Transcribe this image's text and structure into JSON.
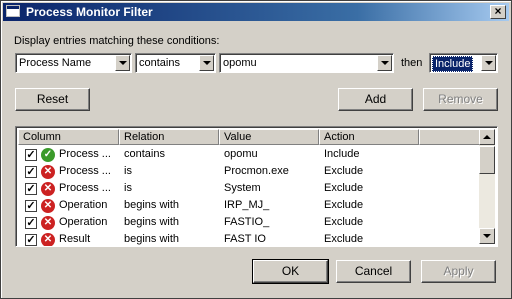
{
  "window": {
    "title": "Process Monitor Filter"
  },
  "filter": {
    "prompt": "Display entries matching these conditions:",
    "column": "Process Name",
    "relation": "contains",
    "value": "opomu",
    "then_label": "then",
    "action": "Include"
  },
  "buttons": {
    "reset": "Reset",
    "add": "Add",
    "remove": "Remove",
    "ok": "OK",
    "cancel": "Cancel",
    "apply": "Apply"
  },
  "list": {
    "headers": [
      "Column",
      "Relation",
      "Value",
      "Action"
    ],
    "rows": [
      {
        "checked": true,
        "status": "include",
        "column": "Process ...",
        "relation": "contains",
        "value": "opomu",
        "action": "Include"
      },
      {
        "checked": true,
        "status": "exclude",
        "column": "Process ...",
        "relation": "is",
        "value": "Procmon.exe",
        "action": "Exclude"
      },
      {
        "checked": true,
        "status": "exclude",
        "column": "Process ...",
        "relation": "is",
        "value": "System",
        "action": "Exclude"
      },
      {
        "checked": true,
        "status": "exclude",
        "column": "Operation",
        "relation": "begins with",
        "value": "IRP_MJ_",
        "action": "Exclude"
      },
      {
        "checked": true,
        "status": "exclude",
        "column": "Operation",
        "relation": "begins with",
        "value": "FASTIO_",
        "action": "Exclude"
      },
      {
        "checked": true,
        "status": "exclude",
        "column": "Result",
        "relation": "begins with",
        "value": "FAST IO",
        "action": "Exclude"
      }
    ]
  },
  "colors": {
    "title_bar": "#0a246a",
    "include_icon": "#3a9a2a",
    "exclude_icon": "#cc2222"
  }
}
